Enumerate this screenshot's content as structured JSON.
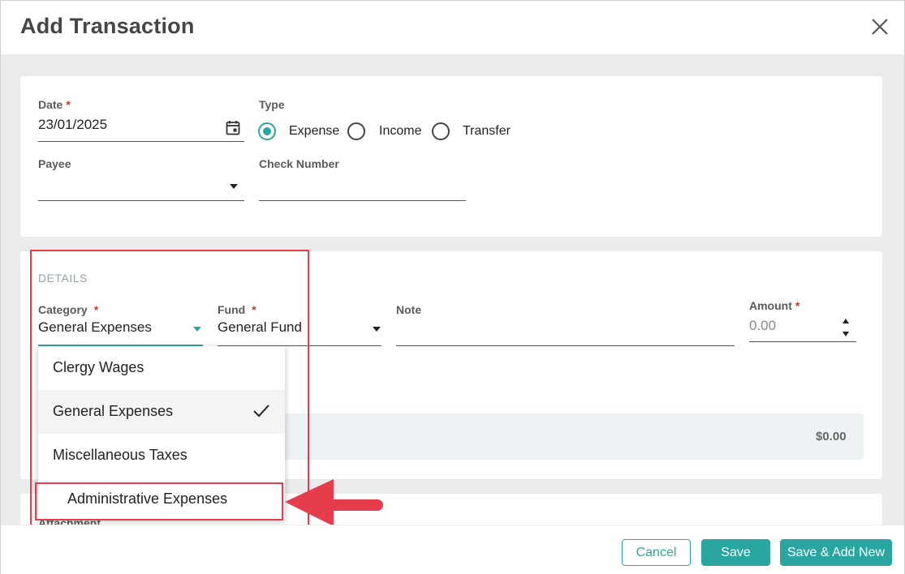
{
  "dialog": {
    "title": "Add Transaction"
  },
  "form": {
    "date": {
      "label": "Date",
      "required_mark": "*",
      "value": "23/01/2025"
    },
    "type": {
      "label": "Type",
      "options": [
        "Expense",
        "Income",
        "Transfer"
      ],
      "selected": "Expense"
    },
    "payee": {
      "label": "Payee",
      "value": ""
    },
    "check_number": {
      "label": "Check Number",
      "value": ""
    }
  },
  "details": {
    "header": "DETAILS",
    "category": {
      "label": "Category",
      "required_mark": "*",
      "value": "General Expenses"
    },
    "fund": {
      "label": "Fund",
      "required_mark": "*",
      "value": "General Fund"
    },
    "note": {
      "label": "Note",
      "value": ""
    },
    "amount": {
      "label": "Amount",
      "required_mark": "*",
      "placeholder": "0.00"
    },
    "total": "$0.00"
  },
  "category_dropdown": {
    "options": [
      "Clergy Wages",
      "General Expenses",
      "Miscellaneous Taxes",
      "Administrative Expenses"
    ],
    "selected": "General Expenses"
  },
  "attachment_section": {
    "label_partial": "Attachment"
  },
  "footer": {
    "cancel_label": "Cancel",
    "save_label": "Save",
    "save_add_label": "Save & Add New"
  },
  "colors": {
    "accent": "#2aa6a0",
    "highlight": "#e53d4b",
    "required": "#c0392b"
  },
  "icons": [
    "close-icon",
    "calendar-icon",
    "dropdown-arrow-icon",
    "checkmark-icon",
    "spinner-up-icon",
    "spinner-down-icon",
    "arrow-pointer-icon"
  ]
}
